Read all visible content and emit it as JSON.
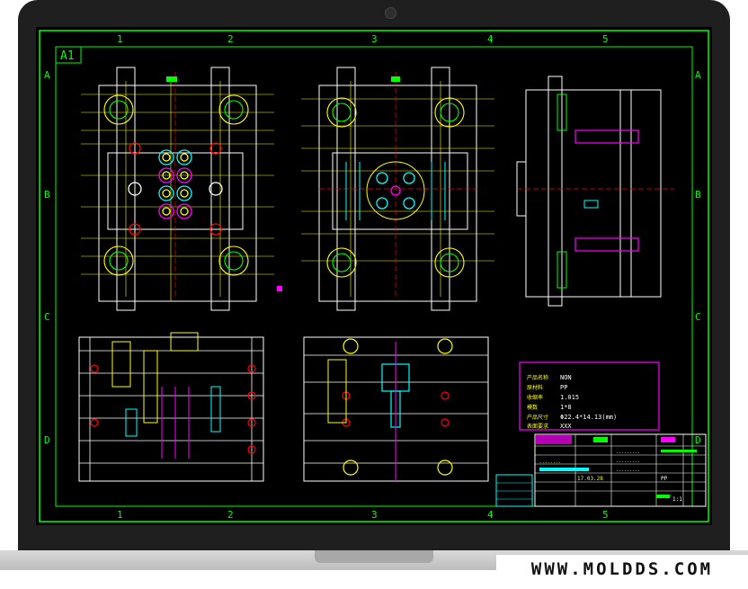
{
  "sheet": {
    "size_label": "A1",
    "col_labels": [
      "1",
      "2",
      "3",
      "4",
      "5"
    ],
    "row_labels": [
      "A",
      "B",
      "C",
      "D"
    ]
  },
  "notes": {
    "line1_label": "产品名称",
    "line1_value": "NON",
    "line2_label": "原材料",
    "line2_value": "PP",
    "line3_label": "收缩率",
    "line3_value": "1.015",
    "line4_label": "模数",
    "line4_value": "1*8",
    "line5_label": "产品尺寸",
    "line5_value": "Φ22.4*14.13(mm)",
    "line6_label": "表面要求",
    "line6_value": "XXX"
  },
  "title_block": {
    "date": "17.03.28",
    "material": "PP",
    "scale": "1:1"
  },
  "colors": {
    "screen_bg": "#000000",
    "frame": "#00ff00",
    "cad_white": "#ffffff",
    "cad_yellow": "#ffff00",
    "cad_magenta": "#ff00ff",
    "cad_cyan": "#00ffff",
    "cad_red": "#ff0000"
  },
  "footer": {
    "site": "WWW.MOLDDS.COM"
  }
}
